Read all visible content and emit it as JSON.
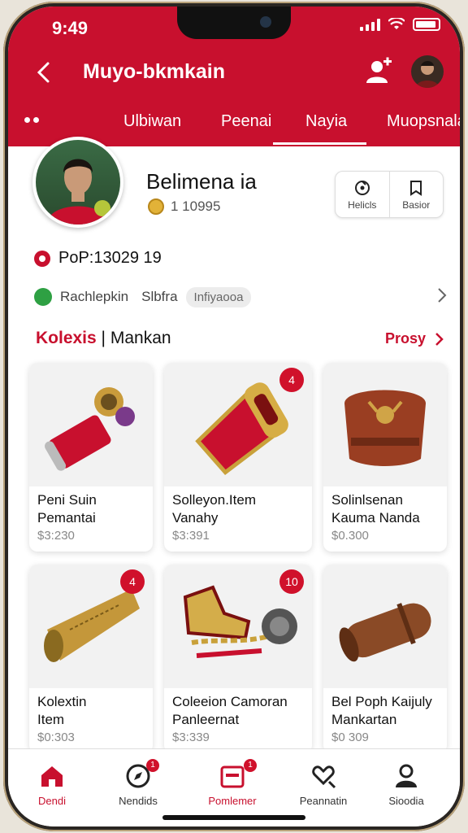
{
  "status": {
    "time": "9:49"
  },
  "header": {
    "title": "Muyo-bkmkain",
    "tabs": [
      "Ulbiwan",
      "Peenai",
      "Nayia",
      "Muopsnala"
    ],
    "active_tab": 2
  },
  "profile": {
    "name": "Belimena ia",
    "coins": "1 10995",
    "actions": [
      {
        "label": "Helicls",
        "icon": "target-icon"
      },
      {
        "label": "Basior",
        "icon": "bookmark-icon"
      }
    ],
    "pop": "PoP:13029 19",
    "info": {
      "name": "Rachlepkin",
      "meta": "Slbfra",
      "chip": "Infiyaooa"
    }
  },
  "section": {
    "title_red": "Kolexis",
    "title_sep": "|",
    "title_black": "Mankan",
    "more_label": "Prosy"
  },
  "items": [
    {
      "name_line1": "Peni Suin",
      "name_line2": "Pemantai",
      "price": "$3:230",
      "badge": ""
    },
    {
      "name_line1": "Solleyon.Item",
      "name_line2": "Vanahy",
      "price": "$3:391",
      "badge": "4"
    },
    {
      "name_line1": "Solinlsenan",
      "name_line2": "Kauma Nanda",
      "price": "$0.300",
      "badge": ""
    },
    {
      "name_line1": "Kolextin",
      "name_line2": "Item",
      "price": "$0:303",
      "badge": "4"
    },
    {
      "name_line1": "Coleeion Camoran",
      "name_line2": "Panleernat",
      "price": "$3:339",
      "badge": "10"
    },
    {
      "name_line1": "Bel Poph Kaijuly",
      "name_line2": "Mankartan",
      "price": "$0 309",
      "badge": ""
    }
  ],
  "bottom_nav": [
    {
      "label": "Dendi",
      "icon": "home-icon",
      "badge": ""
    },
    {
      "label": "Nendids",
      "icon": "compass-icon",
      "badge": "1"
    },
    {
      "label": "Pomlemer",
      "icon": "collection-icon",
      "badge": "1"
    },
    {
      "label": "Peannatin",
      "icon": "heart-search-icon",
      "badge": ""
    },
    {
      "label": "Sioodia",
      "icon": "profile-icon",
      "badge": ""
    }
  ],
  "colors": {
    "primary": "#c8102e",
    "badge": "#d0112b",
    "text": "#111111",
    "muted": "#888888"
  }
}
